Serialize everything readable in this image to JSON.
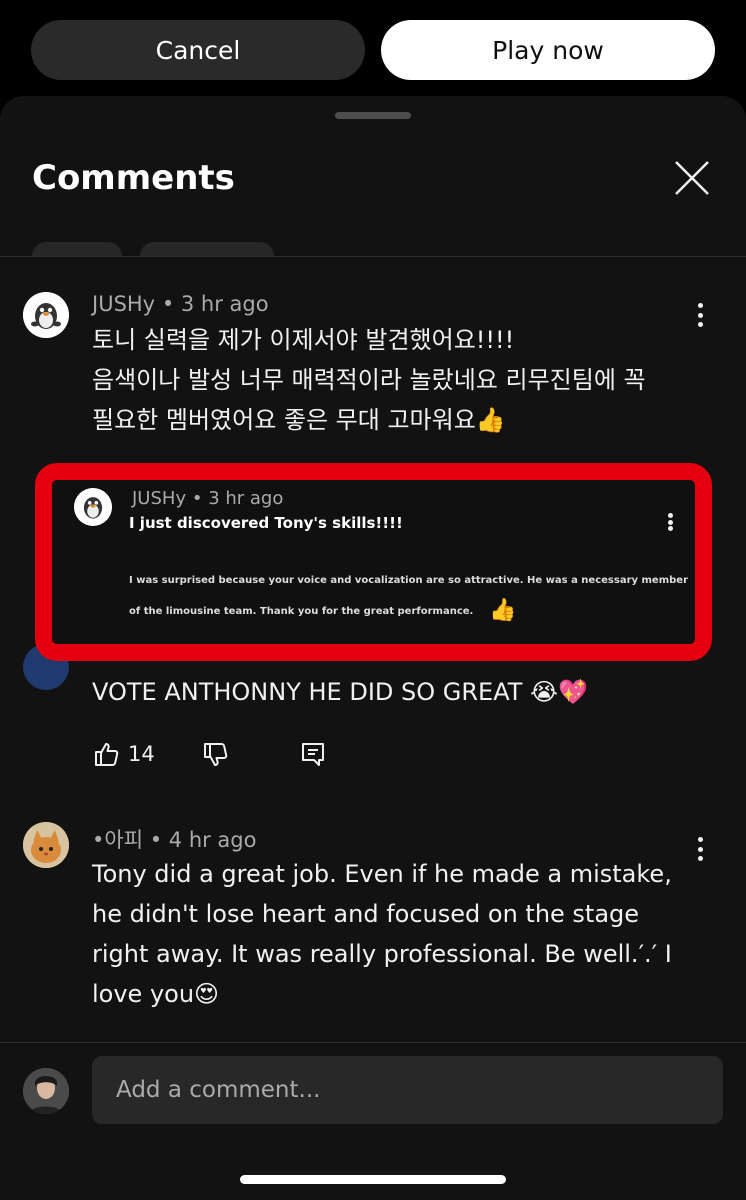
{
  "topbar": {
    "cancel_label": "Cancel",
    "play_label": "Play now"
  },
  "sheet": {
    "title": "Comments",
    "close_icon": "close-icon"
  },
  "comments": [
    {
      "author": "JUSHy",
      "time": "3 hr ago",
      "lines": [
        "토니 실력을 제가 이제서야 발견했어요!!!!",
        "음색이나 발성 너무 매력적이라 놀랐네요 리무진팀에 꼭",
        "필요한 멤버였어요 좋은 무대 고마워요👍"
      ]
    },
    {
      "text": "VOTE ANTHONNY HE DID SO GREAT 😭💖",
      "likes": "14"
    },
    {
      "author": "•아피",
      "time": "4 hr ago",
      "lines": [
        "Tony did a great job. Even if he made a mistake,",
        "he didn't lose heart and focused on the stage",
        "right away. It was really professional. Be well.′.′ I",
        "love you😍"
      ]
    }
  ],
  "translation_overlay": {
    "author": "JUSHy",
    "time": "3 hr ago",
    "title": "I just discovered Tony's skills!!!!",
    "line1": "I was surprised because your voice and vocalization are so attractive. He was a necessary member",
    "line2": "of the limousine team. Thank you for the great performance.",
    "emoji": "👍",
    "highlight_color": "#e4000f"
  },
  "composer": {
    "placeholder": "Add a comment..."
  },
  "colors": {
    "background": "#121212",
    "secondary_text": "#aaaaaa"
  }
}
